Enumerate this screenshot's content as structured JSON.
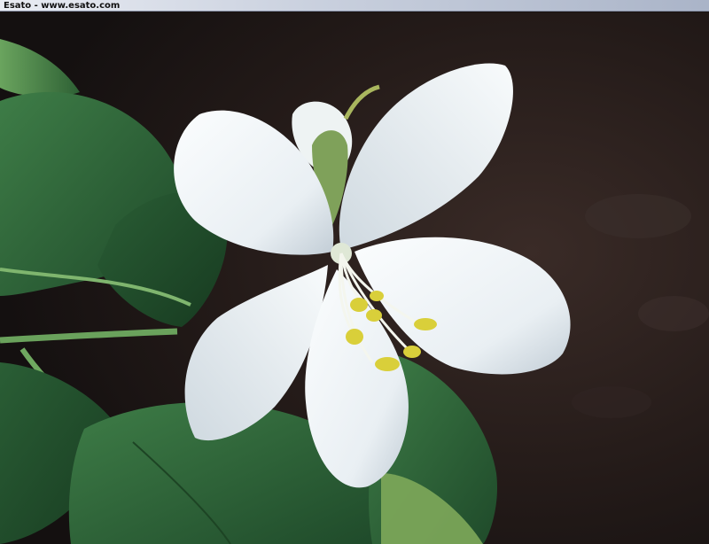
{
  "window": {
    "title": "Esato - www.esato.com"
  },
  "photo": {
    "subject": "white-flower-icon",
    "colors": {
      "background_dark": "#1b1412",
      "leaf_green": "#2f6a3c",
      "leaf_light": "#5f9a5a",
      "petal_white": "#f2f6f8",
      "petal_shade": "#c9d4db",
      "anther_yellow": "#d8cf3a"
    }
  }
}
